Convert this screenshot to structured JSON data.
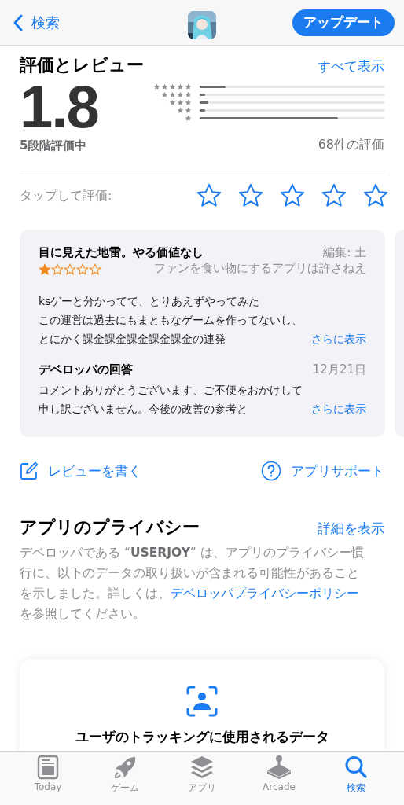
{
  "nav": {
    "back": "検索",
    "update_button": "アップデート"
  },
  "ratings": {
    "title": "評価とレビュー",
    "see_all": "すべて表示",
    "score": "1.8",
    "out_of": "5段階評価中",
    "count": "68件の評価",
    "histogram": [
      {
        "level": 0.14
      },
      {
        "level": 0.03
      },
      {
        "level": 0.045
      },
      {
        "level": 0.03
      },
      {
        "level": 0.75
      }
    ],
    "tap_to_rate": {
      "label": "タップして評価:",
      "stars": 0
    }
  },
  "review": {
    "title": "目に見えた地雷。やる価値なし",
    "meta": "編集: 土",
    "stars": 1,
    "author": "ファンを食い物にするアプリは許さねえ",
    "body": [
      "ksゲーと分かってて、とりあえずやってみた",
      "この運営は過去にもまともなゲームを作ってないし、",
      "とにかく課金課金課金課金課金の連発"
    ],
    "more": "さらに表示",
    "response": {
      "title": "デベロッパの回答",
      "date": "12月21日",
      "body": [
        "コメントありがとうございます、ご不便をおかけして",
        "申し訳ございません。今後の改善の参考と"
      ],
      "more": "さらに表示"
    }
  },
  "actions": [
    {
      "kind": "write",
      "label": "レビューを書く"
    },
    {
      "kind": "support",
      "label": "アプリサポート"
    }
  ],
  "privacy": {
    "title": "アプリのプライバシー",
    "details": "詳細を表示",
    "text_lines": [
      "デベロッパである “**USERJOY**” は、アプリのプライバシー慣",
      "行に、以下のデータの取り扱いが含まれる可能性があること",
      "を示しました。詳しくは、"
    ],
    "link": "デベロッパプライバシーポリシー",
    "text_after": "を参照してください。",
    "card": {
      "title": "ユーザのトラッキングに使用されるデータ"
    }
  },
  "tab_bar": [
    {
      "kind": "today",
      "label": "Today",
      "selected": false
    },
    {
      "kind": "games",
      "label": "ゲーム",
      "selected": false
    },
    {
      "kind": "apps",
      "label": "アプリ",
      "selected": false
    },
    {
      "kind": "arcade",
      "label": "Arcade",
      "selected": false
    },
    {
      "kind": "search",
      "label": "検索",
      "selected": true
    }
  ]
}
